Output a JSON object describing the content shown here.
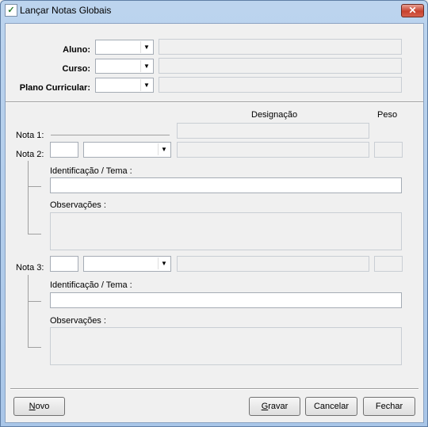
{
  "window": {
    "title": "Lançar Notas Globais",
    "close_glyph": "✕"
  },
  "app_icon": "app-icon",
  "header": {
    "aluno_label": "Aluno:",
    "curso_label": "Curso:",
    "plano_label": "Plano Curricular:"
  },
  "columns": {
    "designacao": "Designação",
    "peso": "Peso"
  },
  "nota1": {
    "label": "Nota 1:"
  },
  "nota2": {
    "label": "Nota 2:",
    "identificacao_label": "Identificação / Tema :",
    "observacoes_label": "Observações :"
  },
  "nota3": {
    "label": "Nota 3:",
    "identificacao_label": "Identificação / Tema :",
    "observacoes_label": "Observações :"
  },
  "buttons": {
    "novo_first": "N",
    "novo_rest": "ovo",
    "gravar_first": "G",
    "gravar_rest": "ravar",
    "cancelar": "Cancelar",
    "fechar": "Fechar"
  }
}
